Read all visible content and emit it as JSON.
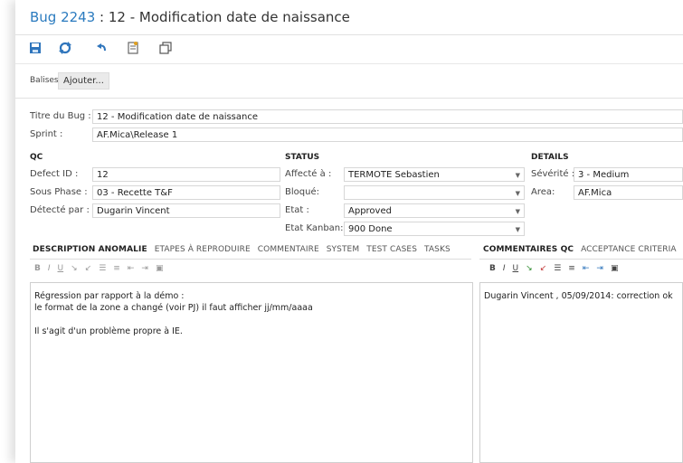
{
  "window": {
    "bug_id": "Bug 2243",
    "separator": " : ",
    "title": "12 - Modification date de naissance"
  },
  "toolbar": {
    "icons": [
      "save-icon",
      "refresh-icon",
      "undo-icon",
      "attach-icon",
      "copy-icon"
    ]
  },
  "tags": {
    "label": "Balises",
    "add_button": "Ajouter..."
  },
  "fields": {
    "title_label": "Titre du Bug :",
    "title_value": "12 - Modification date de naissance",
    "sprint_label": "Sprint :",
    "sprint_value": "AF.Mica\\Release 1"
  },
  "qc": {
    "header": "QC",
    "defect_label": "Defect ID :",
    "defect_value": "12",
    "phase_label": "Sous Phase :",
    "phase_value": "03 - Recette T&F",
    "detected_label": "Détecté par :",
    "detected_value": "Dugarin Vincent"
  },
  "status": {
    "header": "STATUS",
    "assigned_label": "Affecté à :",
    "assigned_value": "TERMOTE Sebastien",
    "blocked_label": "Bloqué:",
    "blocked_value": "",
    "state_label": "Etat :",
    "state_value": "Approved",
    "kanban_label": "Etat Kanban:",
    "kanban_value": "900 Done"
  },
  "details": {
    "header": "DETAILS",
    "severity_label": "Sévérité :",
    "severity_value": "3 - Medium",
    "area_label": "Area:",
    "area_value": "AF.Mica"
  },
  "left_tabs": [
    "DESCRIPTION ANOMALIE",
    "ETAPES À REPRODUIRE",
    "COMMENTAIRE",
    "SYSTEM",
    "TEST CASES",
    "TASKS"
  ],
  "right_tabs": [
    "COMMENTAIRES QC",
    "ACCEPTANCE CRITERIA"
  ],
  "format_buttons": [
    "B",
    "I",
    "U",
    "↘",
    "↙",
    "☰",
    "≡",
    "⇤",
    "⇥",
    "▣"
  ],
  "description": {
    "line1": "Régression par rapport à la démo :",
    "line2": "le format de la zone a changé (voir PJ) il faut afficher jj/mm/aaaa",
    "line3": "Il s'agit d'un problème propre à IE."
  },
  "comments": {
    "line1": "Dugarin Vincent , 05/09/2014: correction ok"
  }
}
